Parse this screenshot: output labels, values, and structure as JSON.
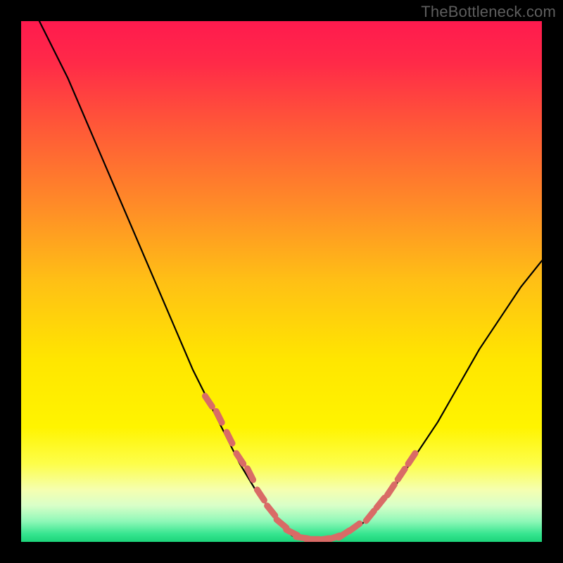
{
  "watermark": "TheBottleneck.com",
  "colors": {
    "frame": "#000000",
    "watermark": "#5e5e5e",
    "gradient_stops": [
      {
        "offset": 0.0,
        "color": "#ff1a4e"
      },
      {
        "offset": 0.08,
        "color": "#ff2a48"
      },
      {
        "offset": 0.2,
        "color": "#ff5738"
      },
      {
        "offset": 0.35,
        "color": "#ff8a28"
      },
      {
        "offset": 0.5,
        "color": "#ffc015"
      },
      {
        "offset": 0.65,
        "color": "#ffe600"
      },
      {
        "offset": 0.78,
        "color": "#fff400"
      },
      {
        "offset": 0.85,
        "color": "#fdfe4a"
      },
      {
        "offset": 0.9,
        "color": "#f5ffb0"
      },
      {
        "offset": 0.93,
        "color": "#d9ffc8"
      },
      {
        "offset": 0.96,
        "color": "#90f8b8"
      },
      {
        "offset": 0.985,
        "color": "#35e58f"
      },
      {
        "offset": 1.0,
        "color": "#1cd47a"
      }
    ],
    "curve": "#000000",
    "markers": "#d96b66"
  },
  "chart_data": {
    "type": "line",
    "title": "",
    "xlabel": "",
    "ylabel": "",
    "xlim": [
      0,
      100
    ],
    "ylim": [
      0,
      100
    ],
    "grid": false,
    "legend": false,
    "series": [
      {
        "name": "curve",
        "x": [
          0,
          3,
          6,
          9,
          12,
          15,
          18,
          21,
          24,
          27,
          30,
          33,
          36,
          39,
          42,
          45,
          48,
          50,
          52,
          54,
          56,
          58,
          60,
          62,
          65,
          68,
          72,
          76,
          80,
          84,
          88,
          92,
          96,
          100
        ],
        "y": [
          106,
          101,
          95,
          89,
          82,
          75,
          68,
          61,
          54,
          47,
          40,
          33,
          27,
          21,
          15,
          10,
          6,
          3,
          1.2,
          0.6,
          0.5,
          0.5,
          0.7,
          1.3,
          3,
          6,
          11,
          17,
          23,
          30,
          37,
          43,
          49,
          54
        ]
      }
    ],
    "markers": {
      "name": "highlighted-points",
      "style": "rounded-dash",
      "x": [
        36,
        38,
        40,
        42,
        44,
        46,
        48,
        50,
        52,
        54,
        56,
        58,
        60,
        62,
        64,
        67,
        69,
        71,
        73,
        75
      ],
      "y": [
        27,
        24,
        20,
        16,
        13,
        9,
        6,
        3.5,
        1.8,
        0.8,
        0.5,
        0.5,
        0.8,
        1.5,
        2.8,
        5,
        7.5,
        10,
        13,
        16
      ]
    }
  }
}
